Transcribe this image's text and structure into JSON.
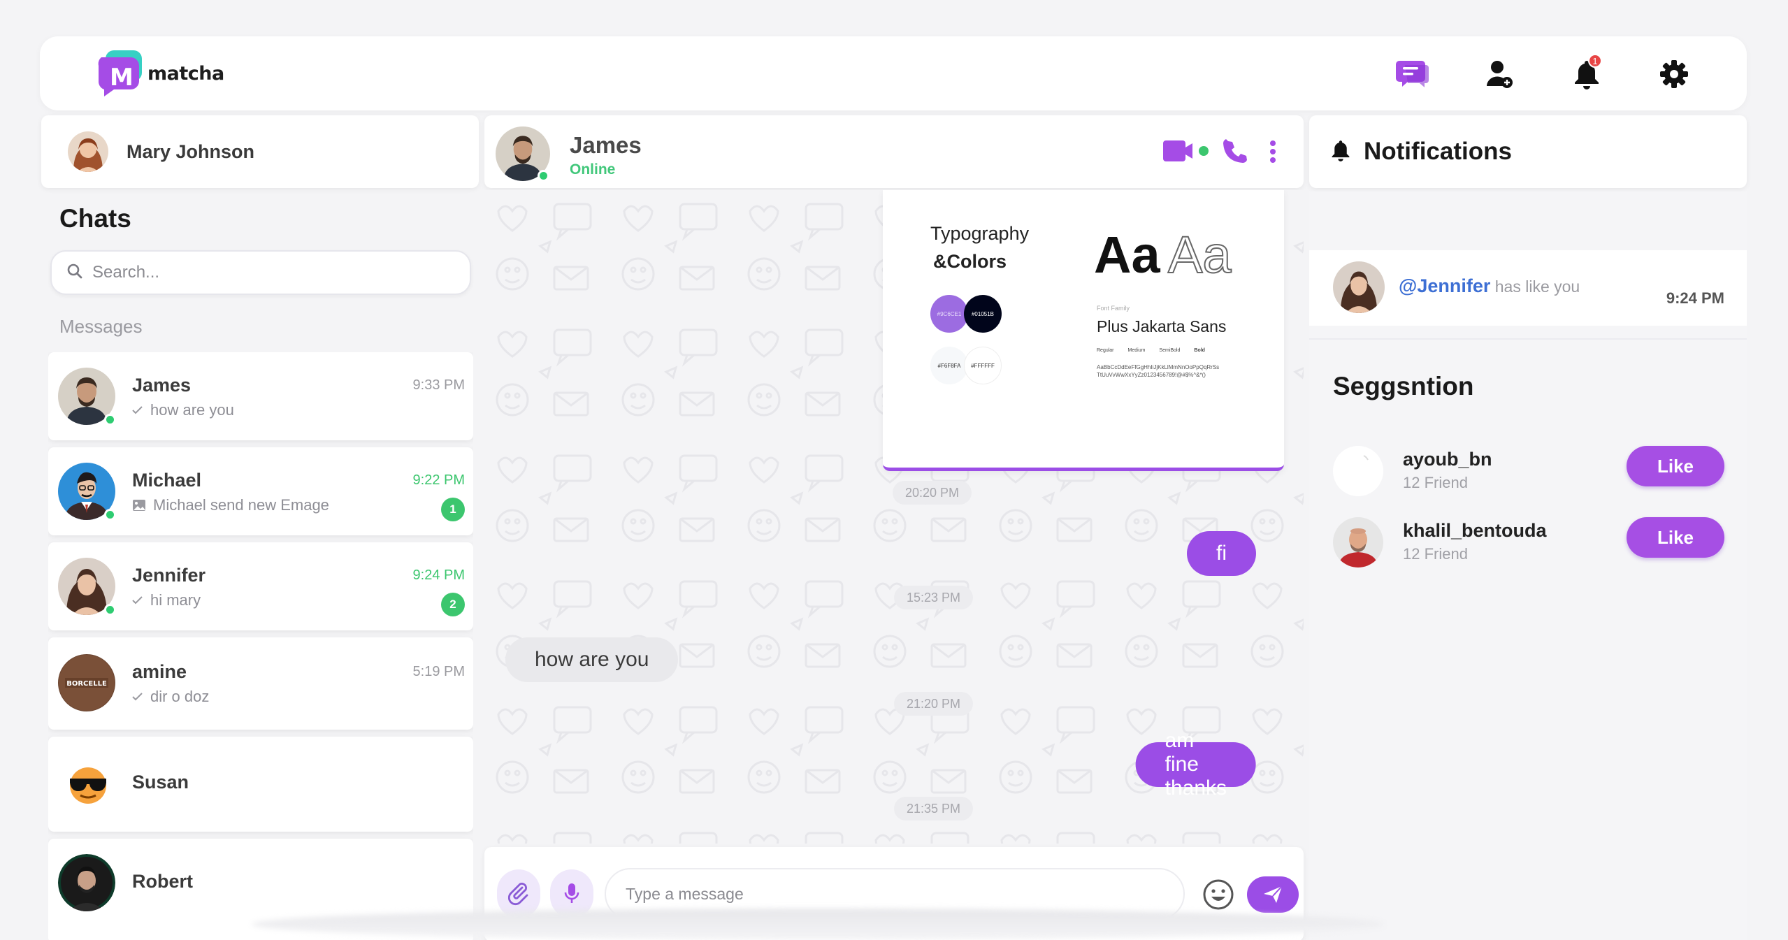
{
  "brand": {
    "name": "matcha",
    "mark_letter": "M"
  },
  "topbar": {
    "icons": [
      "chat-bubbles-icon",
      "add-user-icon",
      "bell-icon",
      "gear-icon"
    ],
    "notification_count": "1"
  },
  "current_user": {
    "name": "Mary Johnson"
  },
  "chats": {
    "title": "Chats",
    "search_placeholder": "Search...",
    "section_label": "Messages",
    "items": [
      {
        "name": "James",
        "preview": "how are you",
        "time": "9:33 PM",
        "unread": "",
        "online": true
      },
      {
        "name": "Michael",
        "preview": "Michael send new Emage",
        "time": "9:22 PM",
        "unread": "1",
        "online": true
      },
      {
        "name": "Jennifer",
        "preview": "hi mary",
        "time": "9:24 PM",
        "unread": "2",
        "online": true
      },
      {
        "name": "amine",
        "preview": "dir o doz",
        "time": "5:19 PM",
        "unread": "",
        "online": false
      },
      {
        "name": "Susan",
        "preview": "",
        "time": "",
        "unread": "",
        "online": false
      },
      {
        "name": "Robert",
        "preview": "",
        "time": "",
        "unread": "",
        "online": false
      }
    ]
  },
  "conversation": {
    "contact_name": "James",
    "status": "Online",
    "shared_image": {
      "title_line1": "Typography",
      "title_line2": "&Colors",
      "swatches": [
        "#9C6CE1",
        "#01051B",
        "#F6F8FA",
        "#FFFFFF"
      ],
      "sample_big": "Aa",
      "font_label": "Font Family",
      "font_name": "Plus Jakarta Sans",
      "weights": [
        "Regular",
        "Medium",
        "SemiBold",
        "Bold"
      ],
      "alphabet1": "AaBbCcDdEeFfGgHhIiJjKkLlMmNnOoPpQqRrSs",
      "alphabet2": "TtUuVvWwXxYyZz0123456789!@#$%^&*()"
    },
    "timestamps": [
      "20:20 PM",
      "15:23 PM",
      "21:20 PM",
      "21:35 PM"
    ],
    "messages": [
      {
        "text": "fi",
        "direction": "out"
      },
      {
        "text": "how are you",
        "direction": "in"
      },
      {
        "text": "am fine thanks",
        "direction": "out"
      }
    ],
    "composer_placeholder": "Type a message"
  },
  "notifications": {
    "title": "Notifications",
    "items": [
      {
        "user": "@Jennifer",
        "text": "has like you",
        "time": "9:24 PM"
      }
    ]
  },
  "suggestions": {
    "title": "Seggsntion",
    "items": [
      {
        "name": "ayoub_bn",
        "friends": "12 Friend",
        "button": "Like"
      },
      {
        "name": "khalil_bentouda",
        "friends": "12 Friend",
        "button": "Like"
      }
    ]
  },
  "colors": {
    "accent": "#9b4de6",
    "online": "#3cc66e",
    "badge": "#e84545"
  }
}
